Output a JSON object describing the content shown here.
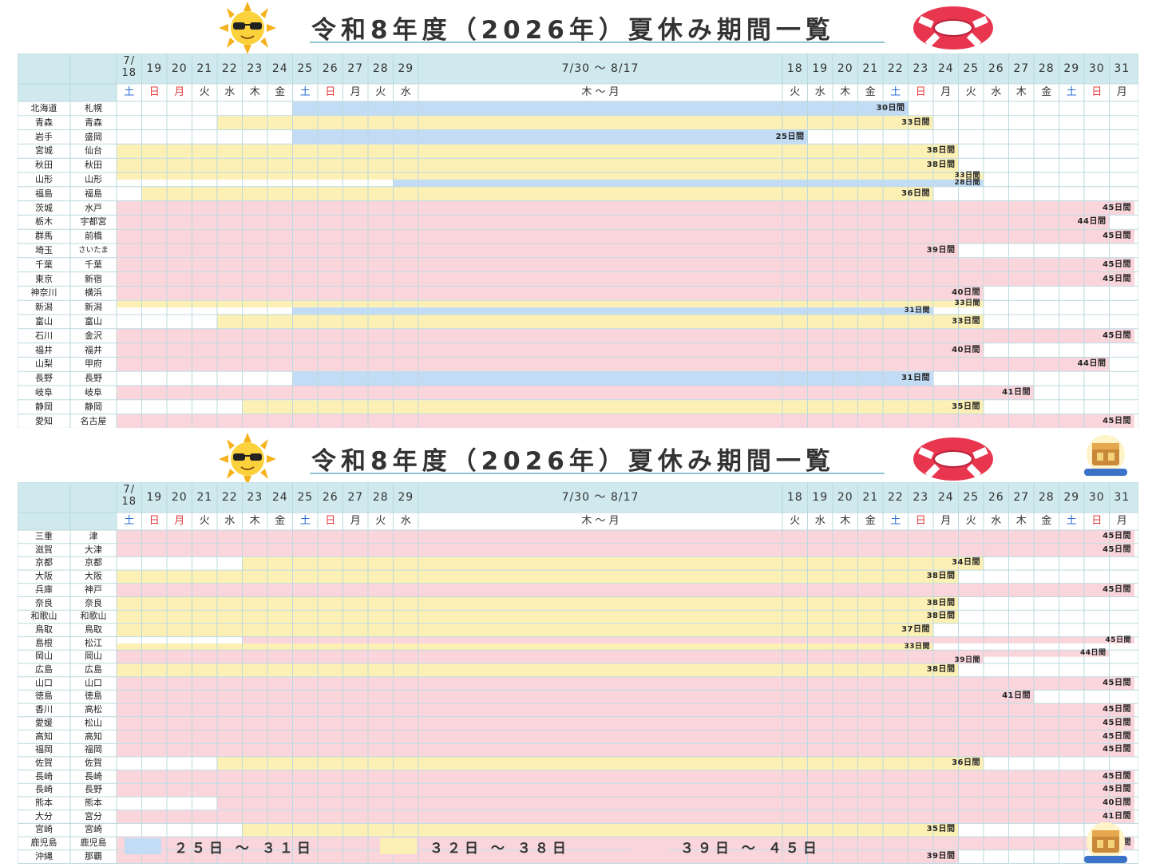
{
  "title": "令和8年度（2026年）夏休み期間一覧",
  "colors": {
    "header_bg": "#cfe9ee",
    "grid_line": "#bcd9de",
    "blue": "#c3dcf6",
    "yellow": "#fdf0b4",
    "pink": "#fbd5dc",
    "sat": "#2a6fd6",
    "sun": "#e33b3b"
  },
  "columns": {
    "dates": [
      "7/\n18",
      "19",
      "20",
      "21",
      "22",
      "23",
      "24",
      "25",
      "26",
      "27",
      "28",
      "29",
      "7/30 ～ 8/17",
      "18",
      "19",
      "20",
      "21",
      "22",
      "23",
      "24",
      "25",
      "26",
      "27",
      "28",
      "29",
      "30",
      "31"
    ],
    "weekdays": [
      "土",
      "日",
      "月",
      "火",
      "水",
      "木",
      "金",
      "土",
      "日",
      "月",
      "火",
      "水",
      "木 ～ 月",
      "火",
      "水",
      "木",
      "金",
      "土",
      "日",
      "月",
      "火",
      "水",
      "木",
      "金",
      "土",
      "日",
      "月"
    ],
    "weekday_types": [
      "sat",
      "sun",
      "sun",
      "",
      "",
      "",
      "",
      "sat",
      "sun",
      "",
      "",
      "",
      "",
      "",
      "",
      "",
      "",
      "sat",
      "sun",
      "",
      "",
      "",
      "",
      "",
      "sat",
      "sun",
      ""
    ]
  },
  "legend": [
    {
      "label": "２５日 ～ ３１日",
      "color": "blue"
    },
    {
      "label": "３２日 ～ ３８日",
      "color": "yellow"
    },
    {
      "label": "３９日 ～ ４５日",
      "color": "pink"
    }
  ],
  "sheets": [
    {
      "rows": [
        {
          "pref": "北海道",
          "city": "札幌",
          "bars": [
            {
              "s": 7,
              "e": 17,
              "c": "blue",
              "label": "30日間"
            }
          ]
        },
        {
          "pref": "青森",
          "city": "青森",
          "bars": [
            {
              "s": 4,
              "e": 18,
              "c": "yellow",
              "label": "33日間"
            }
          ]
        },
        {
          "pref": "岩手",
          "city": "盛岡",
          "bars": [
            {
              "s": 7,
              "e": 13,
              "c": "blue",
              "label": "25日間"
            }
          ]
        },
        {
          "pref": "宮城",
          "city": "仙台",
          "bars": [
            {
              "s": 0,
              "e": 19,
              "c": "yellow",
              "label": "38日間"
            }
          ]
        },
        {
          "pref": "秋田",
          "city": "秋田",
          "bars": [
            {
              "s": 0,
              "e": 19,
              "c": "yellow",
              "label": "38日間"
            }
          ]
        },
        {
          "pref": "山形",
          "city": "山形",
          "bars": [
            {
              "s": 0,
              "e": 20,
              "c": "yellow",
              "label": "33日間"
            },
            {
              "s": 11,
              "e": 20,
              "c": "blue",
              "label": "28日間"
            }
          ]
        },
        {
          "pref": "福島",
          "city": "福島",
          "bars": [
            {
              "s": 1,
              "e": 18,
              "c": "yellow",
              "label": "36日間"
            }
          ]
        },
        {
          "pref": "茨城",
          "city": "水戸",
          "bars": [
            {
              "s": 0,
              "e": 26,
              "c": "pink",
              "label": "45日間"
            }
          ]
        },
        {
          "pref": "栃木",
          "city": "宇都宮",
          "bars": [
            {
              "s": 0,
              "e": 25,
              "c": "pink",
              "label": "44日間"
            }
          ]
        },
        {
          "pref": "群馬",
          "city": "前橋",
          "bars": [
            {
              "s": 0,
              "e": 26,
              "c": "pink",
              "label": "45日間"
            }
          ]
        },
        {
          "pref": "埼玉",
          "city": "さいたま",
          "bars": [
            {
              "s": 0,
              "e": 19,
              "c": "pink",
              "label": "39日間"
            }
          ]
        },
        {
          "pref": "千葉",
          "city": "千葉",
          "bars": [
            {
              "s": 0,
              "e": 26,
              "c": "pink",
              "label": "45日間"
            }
          ]
        },
        {
          "pref": "東京",
          "city": "新宿",
          "bars": [
            {
              "s": 0,
              "e": 26,
              "c": "pink",
              "label": "45日間"
            }
          ]
        },
        {
          "pref": "神奈川",
          "city": "横浜",
          "bars": [
            {
              "s": 0,
              "e": 20,
              "c": "pink",
              "label": "40日間"
            }
          ]
        },
        {
          "pref": "新潟",
          "city": "新潟",
          "bars": [
            {
              "s": 0,
              "e": 20,
              "c": "yellow",
              "label": "33日間"
            },
            {
              "s": 7,
              "e": 18,
              "c": "blue",
              "label": "31日間"
            }
          ]
        },
        {
          "pref": "富山",
          "city": "富山",
          "bars": [
            {
              "s": 4,
              "e": 20,
              "c": "yellow",
              "label": "33日間"
            }
          ]
        },
        {
          "pref": "石川",
          "city": "金沢",
          "bars": [
            {
              "s": 0,
              "e": 26,
              "c": "pink",
              "label": "45日間"
            }
          ]
        },
        {
          "pref": "福井",
          "city": "福井",
          "bars": [
            {
              "s": 0,
              "e": 20,
              "c": "pink",
              "label": "40日間"
            }
          ]
        },
        {
          "pref": "山梨",
          "city": "甲府",
          "bars": [
            {
              "s": 0,
              "e": 25,
              "c": "pink",
              "label": "44日間"
            }
          ]
        },
        {
          "pref": "長野",
          "city": "長野",
          "bars": [
            {
              "s": 7,
              "e": 18,
              "c": "blue",
              "label": "31日間"
            }
          ]
        },
        {
          "pref": "岐阜",
          "city": "岐阜",
          "bars": [
            {
              "s": 0,
              "e": 22,
              "c": "pink",
              "label": "41日間"
            }
          ]
        },
        {
          "pref": "静岡",
          "city": "静岡",
          "bars": [
            {
              "s": 5,
              "e": 20,
              "c": "yellow",
              "label": "35日間"
            }
          ]
        },
        {
          "pref": "愛知",
          "city": "名古屋",
          "bars": [
            {
              "s": 0,
              "e": 26,
              "c": "pink",
              "label": "45日間"
            }
          ]
        }
      ]
    },
    {
      "rows": [
        {
          "pref": "三重",
          "city": "津",
          "bars": [
            {
              "s": 0,
              "e": 26,
              "c": "pink",
              "label": "45日間"
            }
          ]
        },
        {
          "pref": "滋賀",
          "city": "大津",
          "bars": [
            {
              "s": 0,
              "e": 26,
              "c": "pink",
              "label": "45日間"
            }
          ]
        },
        {
          "pref": "京都",
          "city": "京都",
          "bars": [
            {
              "s": 5,
              "e": 20,
              "c": "yellow",
              "label": "34日間"
            }
          ]
        },
        {
          "pref": "大阪",
          "city": "大阪",
          "bars": [
            {
              "s": 0,
              "e": 19,
              "c": "yellow",
              "label": "38日間"
            }
          ]
        },
        {
          "pref": "兵庫",
          "city": "神戸",
          "bars": [
            {
              "s": 0,
              "e": 26,
              "c": "pink",
              "label": "45日間"
            }
          ]
        },
        {
          "pref": "奈良",
          "city": "奈良",
          "bars": [
            {
              "s": 0,
              "e": 19,
              "c": "yellow",
              "label": "38日間"
            }
          ]
        },
        {
          "pref": "和歌山",
          "city": "和歌山",
          "bars": [
            {
              "s": 0,
              "e": 19,
              "c": "yellow",
              "label": "38日間"
            }
          ]
        },
        {
          "pref": "鳥取",
          "city": "鳥取",
          "bars": [
            {
              "s": 0,
              "e": 18,
              "c": "yellow",
              "label": "37日間"
            }
          ]
        },
        {
          "pref": "島根",
          "city": "松江",
          "bars": [
            {
              "s": 5,
              "e": 26,
              "c": "pink",
              "label": "45日間"
            },
            {
              "s": 0,
              "e": 18,
              "c": "yellow",
              "label": "33日間"
            }
          ]
        },
        {
          "pref": "岡山",
          "city": "岡山",
          "bars": [
            {
              "s": 0,
              "e": 25,
              "c": "pink",
              "label": "44日間"
            },
            {
              "s": 0,
              "e": 20,
              "c": "pink",
              "label": "39日間"
            }
          ]
        },
        {
          "pref": "広島",
          "city": "広島",
          "bars": [
            {
              "s": 0,
              "e": 19,
              "c": "yellow",
              "label": "38日間"
            }
          ]
        },
        {
          "pref": "山口",
          "city": "山口",
          "bars": [
            {
              "s": 0,
              "e": 26,
              "c": "pink",
              "label": "45日間"
            }
          ]
        },
        {
          "pref": "徳島",
          "city": "徳島",
          "bars": [
            {
              "s": 0,
              "e": 22,
              "c": "pink",
              "label": "41日間"
            }
          ]
        },
        {
          "pref": "香川",
          "city": "高松",
          "bars": [
            {
              "s": 0,
              "e": 26,
              "c": "pink",
              "label": "45日間"
            }
          ]
        },
        {
          "pref": "愛媛",
          "city": "松山",
          "bars": [
            {
              "s": 0,
              "e": 26,
              "c": "pink",
              "label": "45日間"
            }
          ]
        },
        {
          "pref": "高知",
          "city": "高知",
          "bars": [
            {
              "s": 0,
              "e": 26,
              "c": "pink",
              "label": "45日間"
            }
          ]
        },
        {
          "pref": "福岡",
          "city": "福岡",
          "bars": [
            {
              "s": 0,
              "e": 26,
              "c": "pink",
              "label": "45日間"
            }
          ]
        },
        {
          "pref": "佐賀",
          "city": "佐賀",
          "bars": [
            {
              "s": 4,
              "e": 20,
              "c": "yellow",
              "label": "36日間"
            }
          ]
        },
        {
          "pref": "長崎",
          "city": "長崎",
          "bars": [
            {
              "s": 0,
              "e": 26,
              "c": "pink",
              "label": "45日間"
            }
          ]
        },
        {
          "pref": "長崎",
          "city": "長野",
          "bars": [
            {
              "s": 0,
              "e": 26,
              "c": "pink",
              "label": "45日間"
            }
          ]
        },
        {
          "pref": "熊本",
          "city": "熊本",
          "bars": [
            {
              "s": 4,
              "e": 26,
              "c": "pink",
              "label": "40日間"
            }
          ]
        },
        {
          "pref": "大分",
          "city": "宮分",
          "bars": [
            {
              "s": 0,
              "e": 26,
              "c": "pink",
              "label": "41日間"
            }
          ]
        },
        {
          "pref": "宮崎",
          "city": "宮崎",
          "bars": [
            {
              "s": 5,
              "e": 19,
              "c": "yellow",
              "label": "35日間"
            }
          ]
        },
        {
          "pref": "鹿児島",
          "city": "鹿児島",
          "bars": [
            {
              "s": 0,
              "e": 26,
              "c": "pink",
              "label": "45日間"
            }
          ]
        },
        {
          "pref": "沖縄",
          "city": "那覇",
          "bars": [
            {
              "s": 0,
              "e": 19,
              "c": "pink",
              "label": "39日間"
            }
          ]
        }
      ]
    }
  ]
}
